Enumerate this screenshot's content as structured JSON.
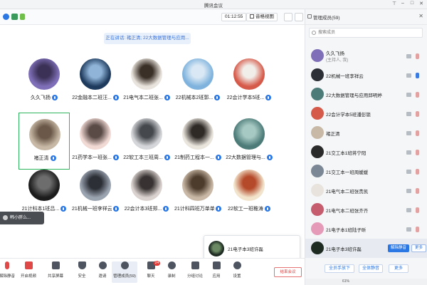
{
  "window": {
    "title": "腾讯会议"
  },
  "topbar": {
    "timer": "01:12:55",
    "view_label": "音格视图"
  },
  "main": {
    "speaking": "正在讲话: 褚正清; 22大数据管理与应用...",
    "tiles": [
      {
        "name": "久久飞扬",
        "color": "#7f6fb8",
        "color2": "#3b3156"
      },
      {
        "name": "22金融本二班汪...",
        "color": "#1e3a5c",
        "color2": "#8fb4d8"
      },
      {
        "name": "21电气本二班张...",
        "color": "#e8e3dc",
        "color2": "#3a3028"
      },
      {
        "name": "22机械本2班郭...",
        "color": "#7fb3dd",
        "color2": "#d9e8f4"
      },
      {
        "name": "22会计学本5班...",
        "color": "#d65a4a",
        "color2": "#f1ede8"
      },
      {
        "name": "褚正清",
        "color": "#c8b9a6",
        "color2": "#6b5848",
        "selected": true
      },
      {
        "name": "21药学本一班张...",
        "color": "#f1d9d4",
        "color2": "#5a4b47"
      },
      {
        "name": "22软工本三班周...",
        "color": "#d4d6d9",
        "color2": "#45484d"
      },
      {
        "name": "21制药工程本一...",
        "color": "#e9e4dc",
        "color2": "#2f2a26"
      },
      {
        "name": "22大数据管理与...",
        "color": "#4c7b78",
        "color2": "#a7c9c3"
      },
      {
        "name": "21计科本1班吕...",
        "color": "#1c1c1c",
        "color2": "#6d6d6d"
      },
      {
        "name": "21机械一班李祥云",
        "color": "#9aa3b0",
        "color2": "#2c2f36"
      },
      {
        "name": "22会计本3班郑...",
        "color": "#d9d2cf",
        "color2": "#383232"
      },
      {
        "name": "21计科四班万单单",
        "color": "#cab8a6",
        "color2": "#4d3c2c"
      },
      {
        "name": "22软工一班稚涛",
        "color": "#f2e4cc",
        "color2": "#b54a2a"
      }
    ],
    "share_pill": "韩小胖么...",
    "popup_name": "21电子本3班许磊"
  },
  "toolbar": {
    "items": [
      {
        "label": "解除静音"
      },
      {
        "label": "开启视频"
      },
      {
        "label": "共享屏幕"
      },
      {
        "label": "安全"
      },
      {
        "label": "邀请"
      },
      {
        "label": "管理成员(59)"
      },
      {
        "label": "聊天"
      },
      {
        "label": "录制"
      },
      {
        "label": "分组讨论"
      },
      {
        "label": "应用"
      },
      {
        "label": "设置"
      }
    ],
    "chat_badge": "24",
    "end_label": "结束会议"
  },
  "panel": {
    "title": "管理成员(59)",
    "search_placeholder": "搜索成员",
    "members": [
      {
        "name": "久久飞扬",
        "sub": "(主持人, 我)",
        "color": "#7f6fb8",
        "mic": "muted",
        "cam": "off"
      },
      {
        "name": "22机械一班李祥云",
        "color": "#2c2f36",
        "mic": "on",
        "cam": "off"
      },
      {
        "name": "22大数据管理与应用邱明婷",
        "color": "#4c7b78",
        "mic": "muted",
        "cam": "off"
      },
      {
        "name": "22会计学本5班潘彭锁",
        "color": "#d65a4a",
        "mic": "muted",
        "cam": "off"
      },
      {
        "name": "褚正清",
        "color": "#c8b9a6",
        "mic": "muted",
        "cam": "off"
      },
      {
        "name": "21交工本1班蒋宁阳",
        "color": "#2a2a2a",
        "mic": "muted",
        "cam": "off"
      },
      {
        "name": "21交工本一班周媛媛",
        "color": "#7b8794",
        "mic": "muted",
        "cam": "off"
      },
      {
        "name": "21电气本二班张贵凯",
        "color": "#e8e3dc",
        "mic": "muted",
        "cam": "off"
      },
      {
        "name": "21电气本二班张齐齐",
        "color": "#c55d6e",
        "mic": "muted",
        "cam": "off"
      },
      {
        "name": "21电子本1班陆子昕",
        "color": "#e59ab7",
        "mic": "muted",
        "cam": "off"
      },
      {
        "name": "21电子本3班许磊",
        "color": "#1d2a22",
        "mic": "muted",
        "cam": "off",
        "highlight": true
      }
    ],
    "unmute_label": "解除静音",
    "more_label": "更多",
    "footer_buttons": [
      "全员手放下",
      "全体静音",
      "更多"
    ],
    "status": "61%"
  },
  "colors": {
    "accent": "#2b78e4",
    "selected_border": "#2fb55c",
    "danger": "#d84343"
  }
}
